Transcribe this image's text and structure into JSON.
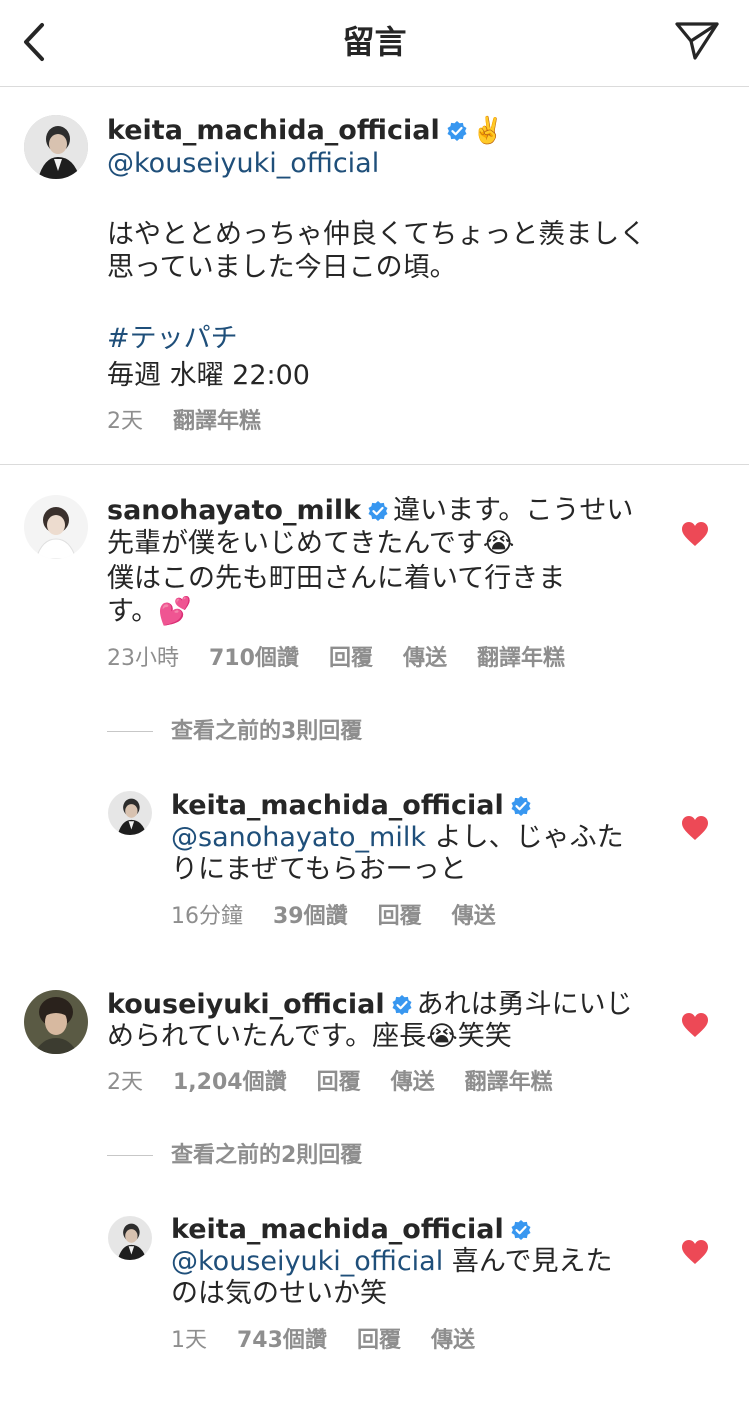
{
  "header": {
    "title": "留言"
  },
  "caption": {
    "username": "keita_machida_official",
    "emoji_after_name": "✌️",
    "mention": "@kouseiyuki_official",
    "text_line1": "はやととめっちゃ仲良くてちょっと羨ましく",
    "text_line2": "思っていました今日この頃。",
    "hashtag": "#テッパチ",
    "schedule": "毎週 水曜 22:00",
    "time": "2天",
    "translate": "翻譯年糕"
  },
  "comments": [
    {
      "username": "sanohayato_milk",
      "line1": "違います。こうせい",
      "line2": "先輩が僕をいじめてきたんです😭",
      "line3": "僕はこの先も町田さんに着いて行きま",
      "line4": "す。💕",
      "time": "23小時",
      "likes": "710個讚",
      "reply": "回覆",
      "send": "傳送",
      "translate": "翻譯年糕",
      "view_replies": "查看之前的3則回覆",
      "liked": true
    },
    {
      "username": "keita_machida_official",
      "mention": "@sanohayato_milk",
      "line1": " よし、じゃふた",
      "line2": "りにまぜてもらおーっと",
      "time": "16分鐘",
      "likes": "39個讚",
      "reply": "回覆",
      "send": "傳送",
      "liked": true
    },
    {
      "username": "kouseiyuki_official",
      "line1": "あれは勇斗にいじ",
      "line2": "められていたんです。座長😭笑笑",
      "time": "2天",
      "likes": "1,204個讚",
      "reply": "回覆",
      "send": "傳送",
      "translate": "翻譯年糕",
      "view_replies": "查看之前的2則回覆",
      "liked": true
    },
    {
      "username": "keita_machida_official",
      "mention": "@kouseiyuki_official",
      "line1": " 喜んで見えた",
      "line2": "のは気のせいか笑",
      "time": "1天",
      "likes": "743個讚",
      "reply": "回覆",
      "send": "傳送",
      "liked": true
    }
  ],
  "colors": {
    "text": "#262626",
    "secondary": "#8e8e8e",
    "link": "#1f4f7a",
    "verified": "#3897f0",
    "heart": "#ed4956",
    "divider": "#dbdbdb"
  },
  "icons": {
    "back": "chevron-left-icon",
    "send": "paper-plane-icon",
    "verified": "verified-badge-icon",
    "like": "heart-icon"
  }
}
